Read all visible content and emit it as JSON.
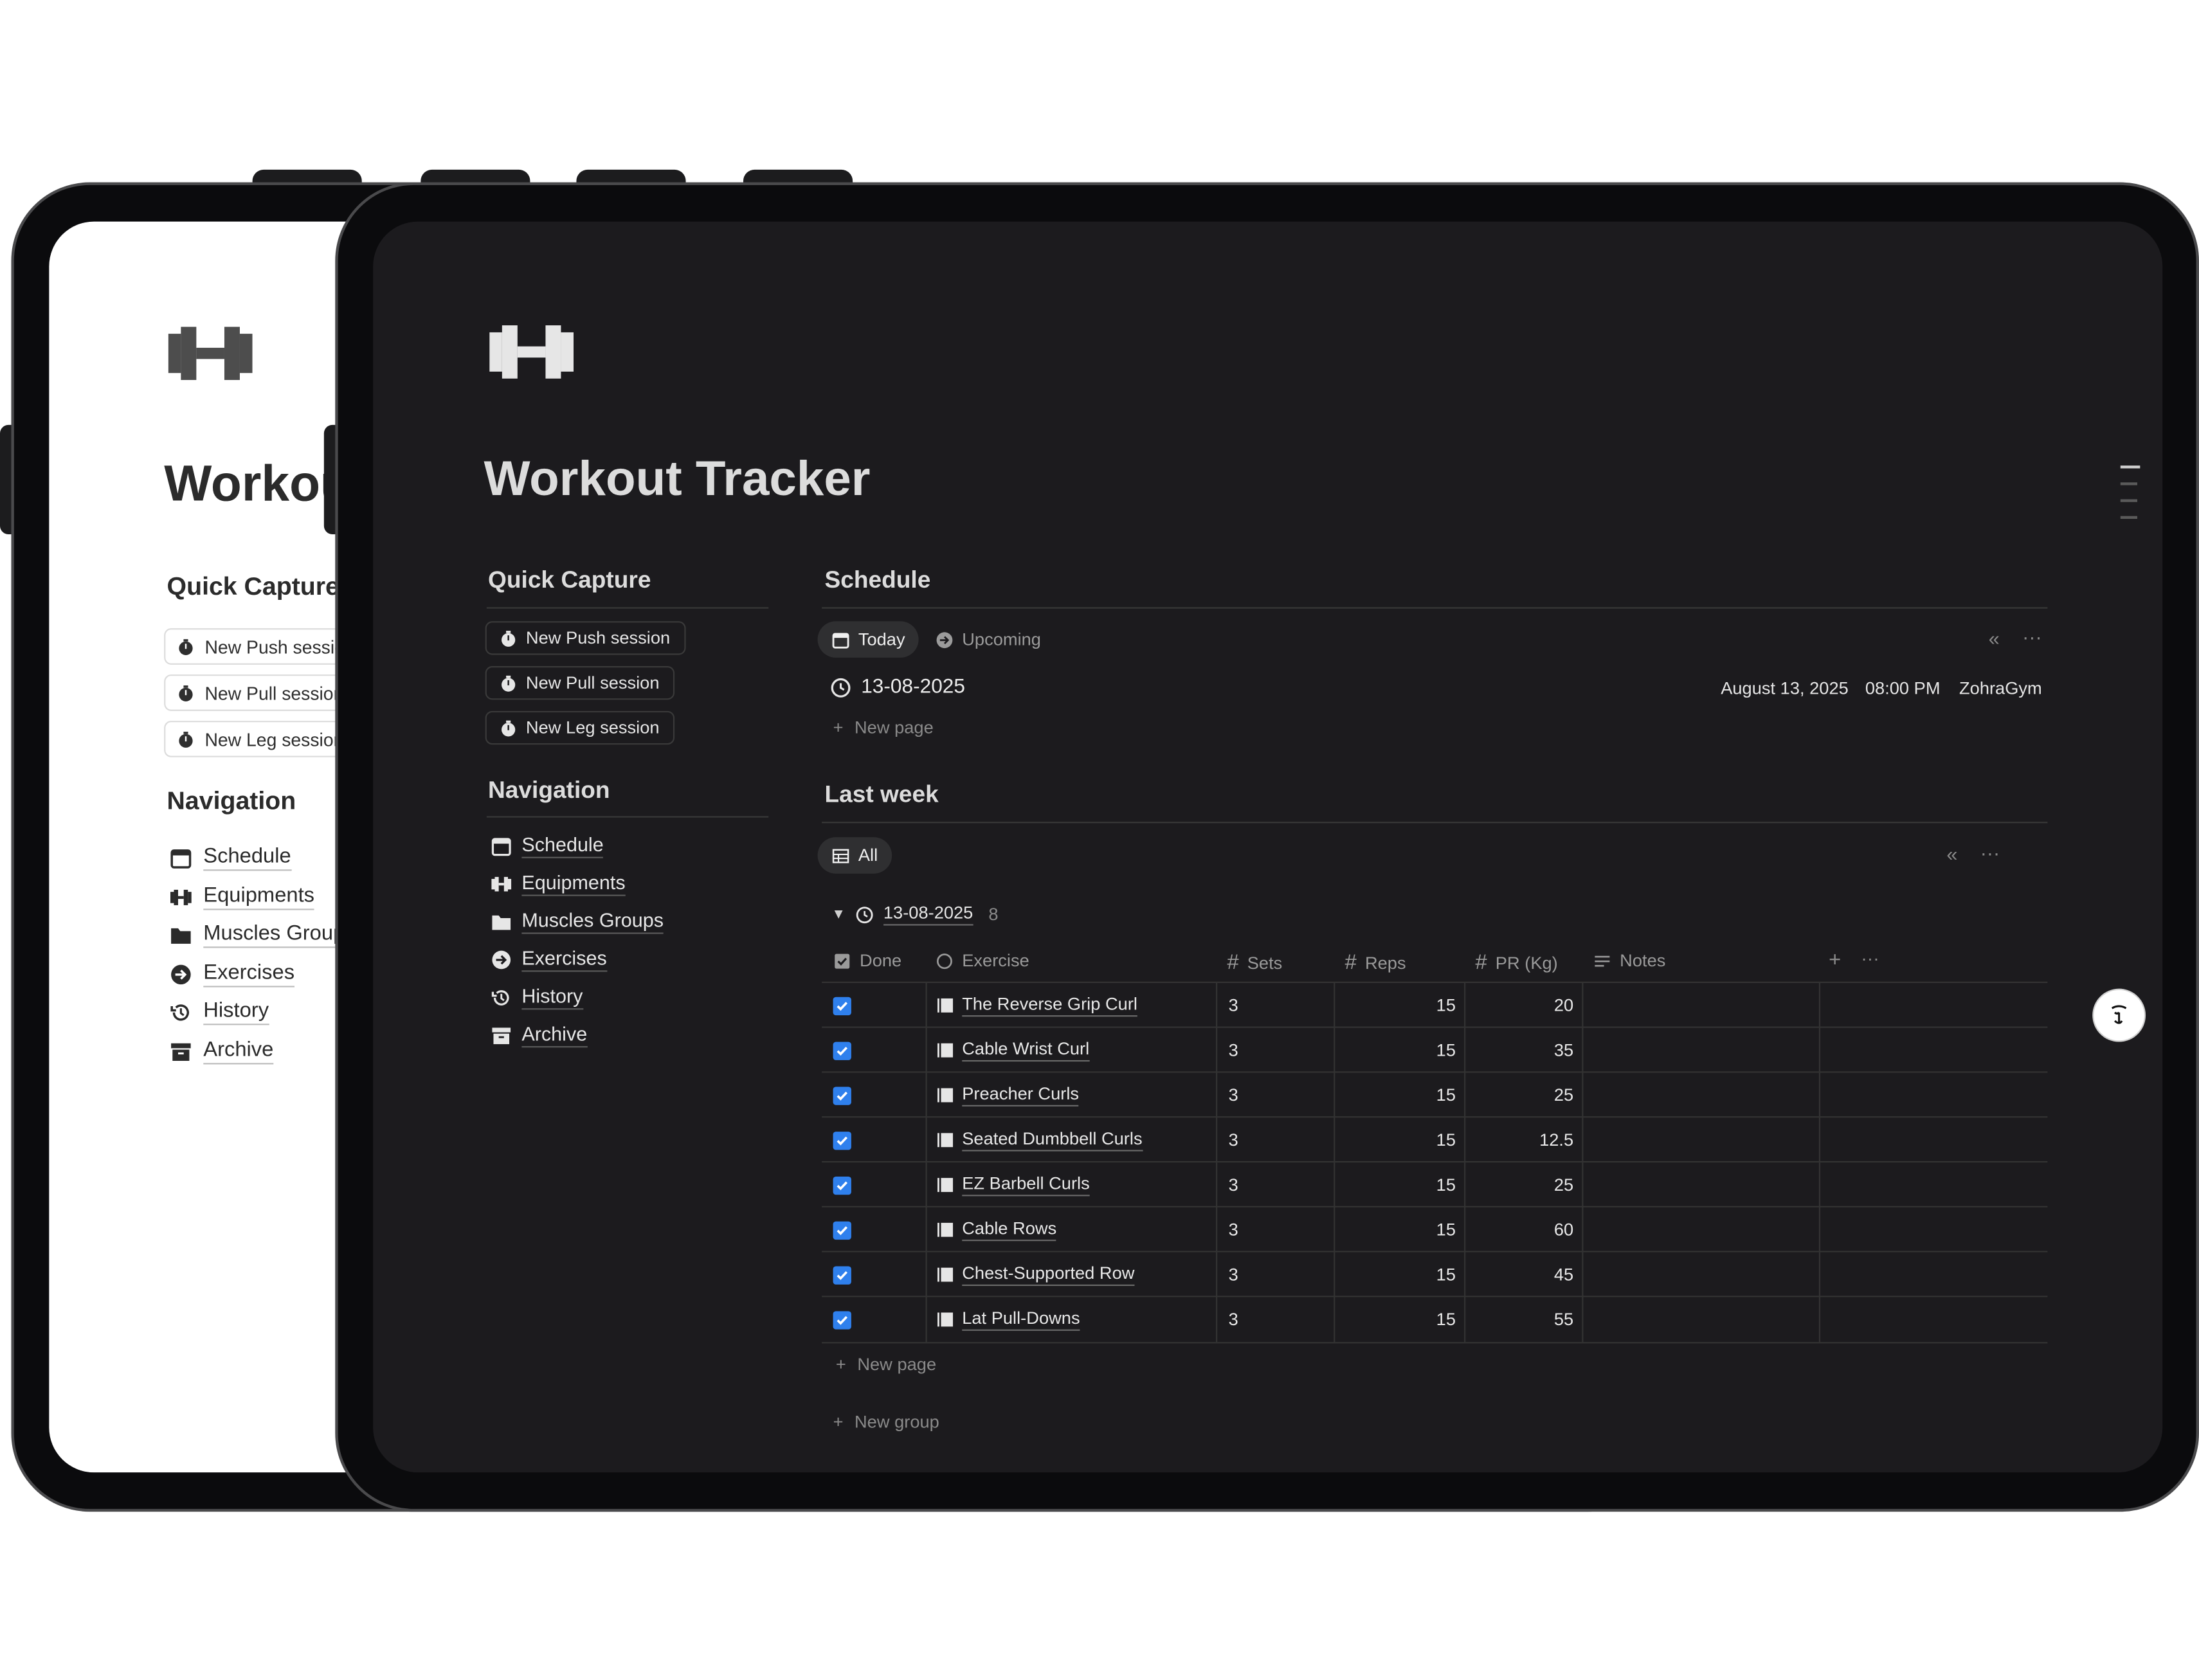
{
  "back_screen": {
    "title": "Workout Tracker",
    "quick_capture": {
      "heading": "Quick Capture",
      "buttons": [
        "New Push session",
        "New Pull session",
        "New Leg session"
      ]
    },
    "navigation": {
      "heading": "Navigation",
      "items": [
        "Schedule",
        "Equipments",
        "Muscles Groups",
        "Exercises",
        "History",
        "Archive"
      ]
    }
  },
  "front_screen": {
    "logo_icon": "dumbbell-icon",
    "title": "Workout Tracker",
    "quick_capture": {
      "heading": "Quick Capture",
      "buttons": [
        "New Push session",
        "New Pull session",
        "New Leg session"
      ]
    },
    "navigation": {
      "heading": "Navigation",
      "items": [
        {
          "label": "Schedule",
          "icon": "calendar-icon"
        },
        {
          "label": "Equipments",
          "icon": "dumbbell-icon"
        },
        {
          "label": "Muscles Groups",
          "icon": "folder-icon"
        },
        {
          "label": "Exercises",
          "icon": "arrow-circle-icon"
        },
        {
          "label": "History",
          "icon": "history-icon"
        },
        {
          "label": "Archive",
          "icon": "archive-icon"
        }
      ]
    },
    "schedule": {
      "heading": "Schedule",
      "tabs": [
        "Today",
        "Upcoming"
      ],
      "entry": {
        "date": "13-08-2025",
        "long_date": "August 13, 2025",
        "time": "08:00 PM",
        "location": "ZohraGym"
      },
      "new_page": "New page"
    },
    "last_week": {
      "heading": "Last week",
      "view_tab": "All",
      "group": {
        "date": "13-08-2025",
        "count": "8"
      },
      "columns": {
        "done": "Done",
        "exercise": "Exercise",
        "sets": "Sets",
        "reps": "Reps",
        "pr": "PR (Kg)",
        "notes": "Notes"
      },
      "rows": [
        {
          "exercise": "The Reverse Grip Curl",
          "sets": "3",
          "reps": "15",
          "pr": "20"
        },
        {
          "exercise": "Cable Wrist Curl",
          "sets": "3",
          "reps": "15",
          "pr": "35"
        },
        {
          "exercise": "Preacher Curls",
          "sets": "3",
          "reps": "15",
          "pr": "25"
        },
        {
          "exercise": "Seated Dumbbell Curls",
          "sets": "3",
          "reps": "15",
          "pr": "12.5"
        },
        {
          "exercise": "EZ Barbell Curls",
          "sets": "3",
          "reps": "15",
          "pr": "25"
        },
        {
          "exercise": "Cable Rows",
          "sets": "3",
          "reps": "15",
          "pr": "60"
        },
        {
          "exercise": "Chest-Supported Row",
          "sets": "3",
          "reps": "15",
          "pr": "45"
        },
        {
          "exercise": "Lat Pull-Downs",
          "sets": "3",
          "reps": "15",
          "pr": "55"
        }
      ],
      "new_page": "New page",
      "new_group": "New group"
    }
  },
  "colors": {
    "accent_checkbox": "#2f80ed",
    "dark_bg": "#1c1b1e",
    "bezel": "#0b0b0d"
  }
}
